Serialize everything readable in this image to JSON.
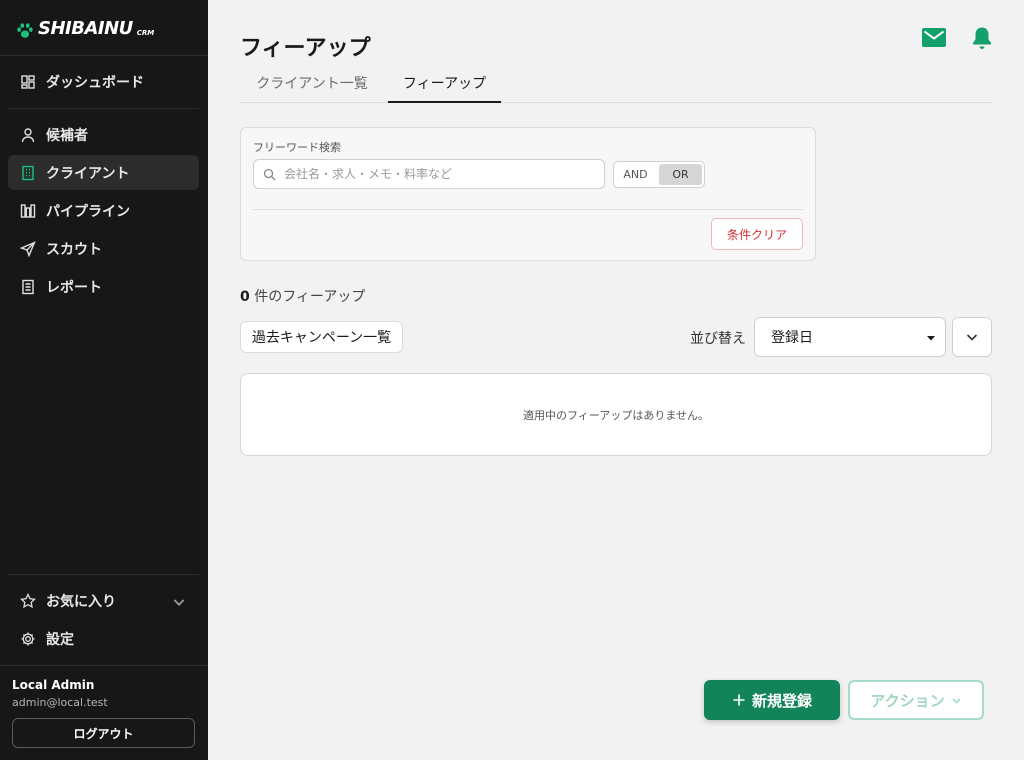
{
  "brand": {
    "name": "SHIBAINU",
    "sub": "CRM"
  },
  "nav": {
    "dashboard": "ダッシュボード",
    "candidates": "候補者",
    "clients": "クライアント",
    "pipeline": "パイプライン",
    "scout": "スカウト",
    "report": "レポート",
    "favorites": "お気に入り",
    "settings": "設定"
  },
  "user": {
    "name": "Local Admin",
    "email": "admin@local.test",
    "logout": "ログアウト"
  },
  "page": {
    "title": "フィーアップ"
  },
  "tabs": [
    {
      "label": "クライアント一覧",
      "active": false
    },
    {
      "label": "フィーアップ",
      "active": true
    }
  ],
  "filter": {
    "label": "フリーワード検索",
    "placeholder": "会社名・求人・メモ・料率など",
    "value": "",
    "logic_options": [
      "AND",
      "OR"
    ],
    "logic_selected": "OR",
    "clear_label": "条件クリア"
  },
  "results": {
    "count": "0",
    "suffix": " 件のフィーアップ",
    "empty_message": "適用中のフィーアップはありません。"
  },
  "toolbar": {
    "past_campaigns": "過去キャンペーン一覧",
    "sort_label": "並び替え",
    "sort_value": "登録日"
  },
  "actions": {
    "new_label": "新規登録",
    "action_label": "アクション"
  },
  "colors": {
    "accent": "#13845a",
    "sidebar_bg": "#171717",
    "danger": "#d62f2f"
  },
  "icons": [
    "paw-icon",
    "dashboard-icon",
    "person-icon",
    "building-icon",
    "pipeline-icon",
    "send-icon",
    "report-icon",
    "star-icon",
    "gear-icon",
    "mail-icon",
    "bell-icon",
    "search-icon",
    "chevron-down-icon",
    "plus-icon"
  ]
}
